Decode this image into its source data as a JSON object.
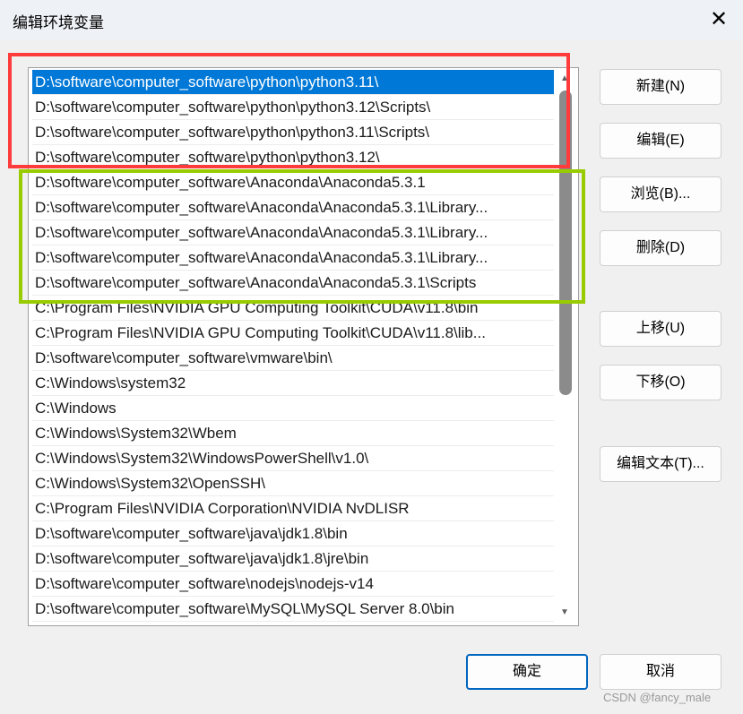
{
  "title": "编辑环境变量",
  "close_label": "✕",
  "paths": [
    "D:\\software\\computer_software\\python\\python3.11\\",
    "D:\\software\\computer_software\\python\\python3.12\\Scripts\\",
    "D:\\software\\computer_software\\python\\python3.11\\Scripts\\",
    "D:\\software\\computer_software\\python\\python3.12\\",
    "D:\\software\\computer_software\\Anaconda\\Anaconda5.3.1",
    "D:\\software\\computer_software\\Anaconda\\Anaconda5.3.1\\Library...",
    "D:\\software\\computer_software\\Anaconda\\Anaconda5.3.1\\Library...",
    "D:\\software\\computer_software\\Anaconda\\Anaconda5.3.1\\Library...",
    "D:\\software\\computer_software\\Anaconda\\Anaconda5.3.1\\Scripts",
    "C:\\Program Files\\NVIDIA GPU Computing Toolkit\\CUDA\\v11.8\\bin",
    "C:\\Program Files\\NVIDIA GPU Computing Toolkit\\CUDA\\v11.8\\lib...",
    "D:\\software\\computer_software\\vmware\\bin\\",
    "C:\\Windows\\system32",
    "C:\\Windows",
    "C:\\Windows\\System32\\Wbem",
    "C:\\Windows\\System32\\WindowsPowerShell\\v1.0\\",
    "C:\\Windows\\System32\\OpenSSH\\",
    "C:\\Program Files\\NVIDIA Corporation\\NVIDIA NvDLISR",
    "D:\\software\\computer_software\\java\\jdk1.8\\bin",
    "D:\\software\\computer_software\\java\\jdk1.8\\jre\\bin",
    "D:\\software\\computer_software\\nodejs\\nodejs-v14",
    "D:\\software\\computer_software\\MySQL\\MySQL Server 8.0\\bin"
  ],
  "selected_index": 0,
  "buttons": {
    "new": "新建(N)",
    "edit": "编辑(E)",
    "browse": "浏览(B)...",
    "delete": "删除(D)",
    "up": "上移(U)",
    "down": "下移(O)",
    "edit_text": "编辑文本(T)...",
    "ok": "确定",
    "cancel": "取消"
  },
  "highlight_colors": {
    "red": "#ff3b3b",
    "green": "#99cc00"
  },
  "watermark": "CSDN @fancy_male"
}
